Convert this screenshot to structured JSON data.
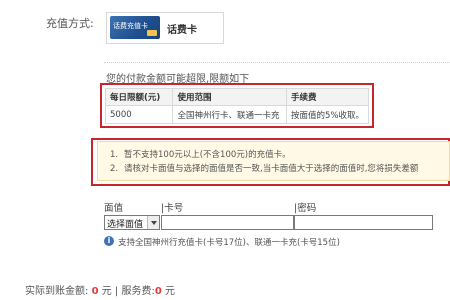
{
  "payment": {
    "label": "充值方式:",
    "card_image_text": "话费充值卡",
    "card_name": "话费卡"
  },
  "limit": {
    "note": "您的付款金额可能超限,限额如下",
    "headers": [
      "每日限额(元)",
      "使用范围",
      "手续费"
    ],
    "row": [
      "5000",
      "全国神州行卡、联通一卡充",
      "按面值的5%收取。"
    ]
  },
  "notice": {
    "items": [
      {
        "num": "1.",
        "text": "暂不支持100元以上(不含100元)的充值卡。"
      },
      {
        "num": "2.",
        "text": "请核对卡面值与选择的面值是否一致,当卡面值大于选择的面值时,您将损失差额"
      }
    ]
  },
  "form": {
    "denomination_label": "面值",
    "card_number_label": "|卡号",
    "password_label": "|密码",
    "denomination_select": "选择面值",
    "card_number_value": "",
    "password_value": "",
    "support_text": "支持全国神州行充值卡(卡号17位)、联通一卡充(卡号15位)"
  },
  "summary": {
    "actual_label": "实际到账金额:",
    "actual_amount": "0",
    "actual_unit": "元",
    "divider": "|",
    "fee_label": "服务费:",
    "fee_amount": "0",
    "fee_unit": "元"
  },
  "colors": {
    "highlight_border": "#c7262e",
    "amount": "#e4393c",
    "notice_bg": "#fff9e6"
  },
  "icons": {
    "info": "info-icon"
  }
}
